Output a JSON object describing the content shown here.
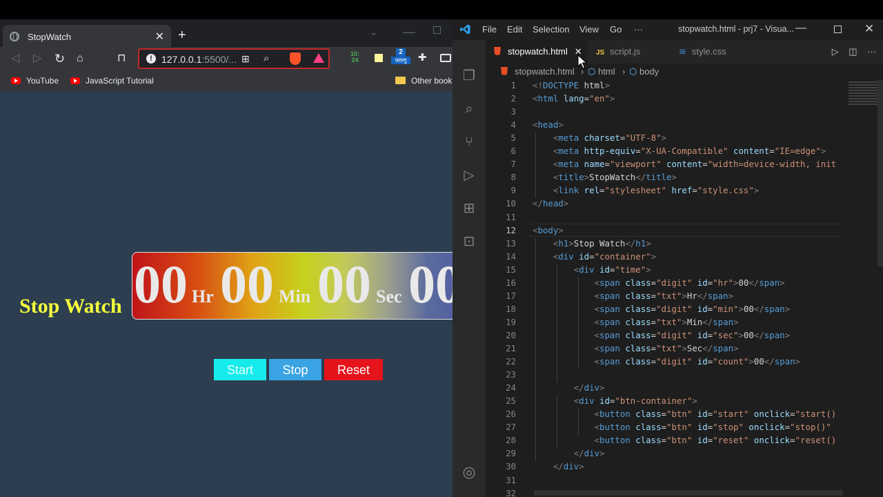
{
  "browser": {
    "tab_title": "StopWatch",
    "tab_close": "✕",
    "new_tab": "+",
    "url_host": "127.0.0.1",
    "url_rest": ":5500/...",
    "bookmarks": [
      {
        "label": "YouTube",
        "icon": "youtube-icon"
      },
      {
        "label": "JavaScript Tutorial",
        "icon": "youtube-icon"
      },
      {
        "label": "Other book",
        "icon": "folder-icon"
      }
    ],
    "extensions": {
      "clock_top": "10:",
      "clock_bottom": "24",
      "calendar_num": "2",
      "calendar_label": "फाल्गु"
    }
  },
  "stopwatch": {
    "heading": "Stop Watch",
    "hr": "00",
    "hr_label": "Hr",
    "min": "00",
    "min_label": "Min",
    "sec": "00",
    "sec_label": "Sec",
    "count": "00",
    "buttons": {
      "start": "Start",
      "stop": "Stop",
      "reset": "Reset"
    },
    "colors": {
      "heading": "#f5ff3c",
      "start": "#16ebeb",
      "stop": "#3aa3e3",
      "reset": "#e4131c",
      "page_bg": "#2c3e50"
    }
  },
  "vscode": {
    "menu": [
      "File",
      "Edit",
      "Selection",
      "View",
      "Go",
      "···"
    ],
    "window_title": "stopwatch.html - prj7 - Visua...",
    "tabs": [
      {
        "label": "stopwatch.html",
        "active": true
      },
      {
        "label": "script.js",
        "active": false
      },
      {
        "label": "style.css",
        "active": false
      }
    ],
    "breadcrumb": [
      "stopwatch.html",
      "html",
      "body"
    ],
    "current_line": "12",
    "line_numbers": [
      "1",
      "2",
      "3",
      "4",
      "5",
      "6",
      "7",
      "8",
      "9",
      "10",
      "11",
      "12",
      "13",
      "14",
      "15",
      "16",
      "17",
      "18",
      "19",
      "20",
      "21",
      "22",
      "23",
      "24",
      "25",
      "26",
      "27",
      "28",
      "29",
      "30",
      "31",
      "32"
    ],
    "code": [
      "<!DOCTYPE html>",
      "<html lang=\"en\">",
      "",
      "<head>",
      "    <meta charset=\"UTF-8\">",
      "    <meta http-equiv=\"X-UA-Compatible\" content=\"IE=edge\">",
      "    <meta name=\"viewport\" content=\"width=device-width, init",
      "    <title>StopWatch</title>",
      "    <link rel=\"stylesheet\" href=\"style.css\">",
      "</head>",
      "",
      "<body>",
      "    <h1>Stop Watch</h1>",
      "    <div id=\"container\">",
      "        <div id=\"time\">",
      "            <span class=\"digit\" id=\"hr\">00</span>",
      "            <span class=\"txt\">Hr</span>",
      "            <span class=\"digit\" id=\"min\">00</span>",
      "            <span class=\"txt\">Min</span>",
      "            <span class=\"digit\" id=\"sec\">00</span>",
      "            <span class=\"txt\">Sec</span>",
      "            <span class=\"digit\" id=\"count\">00</span>",
      "",
      "        </div>",
      "        <div id=\"btn-container\">",
      "            <button class=\"btn\" id=\"start\" onclick=\"start()",
      "            <button class=\"btn\" id=\"stop\" onclick=\"stop()\"",
      "            <button class=\"btn\" id=\"reset\" onclick=\"reset()",
      "        </div>",
      "    </div>",
      "",
      ""
    ]
  }
}
